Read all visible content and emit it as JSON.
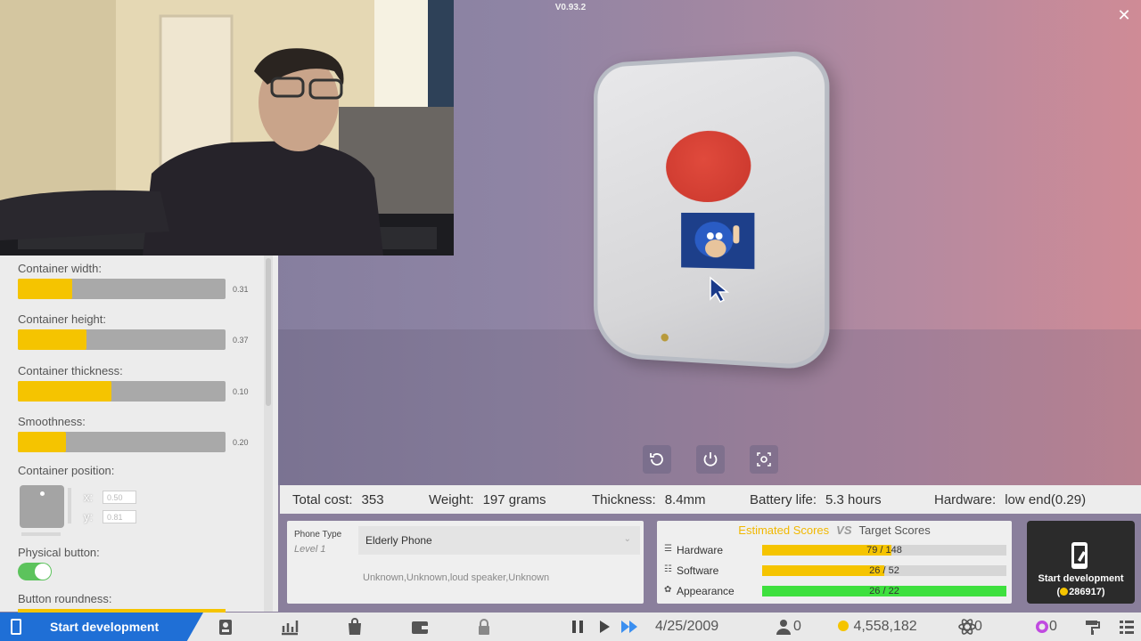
{
  "version": "V0.93.2",
  "stats": {
    "total_cost_label": "Total cost:",
    "total_cost_value": "353",
    "weight_label": "Weight:",
    "weight_value": "197 grams",
    "thickness_label": "Thickness:",
    "thickness_value": "8.4mm",
    "battery_label": "Battery life:",
    "battery_value": "5.3 hours",
    "hardware_label": "Hardware:",
    "hardware_value": "low end(0.29)"
  },
  "settings": {
    "container_width": {
      "label": "Container width:",
      "value": "0.31",
      "fill": 0.26
    },
    "container_height": {
      "label": "Container height:",
      "value": "0.37",
      "fill": 0.33
    },
    "container_thickness": {
      "label": "Container thickness:",
      "value": "0.10",
      "fill": 0.45
    },
    "smoothness": {
      "label": "Smoothness:",
      "value": "0.20",
      "fill": 0.23
    },
    "container_position": {
      "label": "Container position:",
      "x_label": "x:",
      "y_label": "y:",
      "x_value": "0.50",
      "y_value": "0.81"
    },
    "physical_button": {
      "label": "Physical button:",
      "on": true
    },
    "button_roundness": {
      "label": "Button roundness:"
    }
  },
  "phone_type": {
    "label": "Phone Type",
    "level": "Level 1",
    "selected": "Elderly Phone",
    "features": "Unknown,Unknown,loud speaker,Unknown"
  },
  "scores": {
    "estimated_label": "Estimated Scores",
    "vs_label": "VS",
    "target_label": "Target Scores",
    "rows": [
      {
        "name": "Hardware",
        "text": "79 / 148",
        "fraction": 0.53,
        "color": "#f5c400"
      },
      {
        "name": "Software",
        "text": "26 / 52",
        "fraction": 0.5,
        "color": "#f5c400"
      },
      {
        "name": "Appearance",
        "text": "26 / 22",
        "fraction": 1.0,
        "color": "#3ee03e"
      }
    ]
  },
  "start_card": {
    "label": "Start development",
    "cost": "286917"
  },
  "taskbar": {
    "start_label": "Start development",
    "date": "4/25/2009",
    "employees": "0",
    "money": "4,558,182",
    "research": "0",
    "tokens": "0"
  },
  "colors": {
    "accent_yellow": "#f5c400",
    "brand_blue": "#1f6fd6",
    "appearance_green": "#3ee03e"
  }
}
